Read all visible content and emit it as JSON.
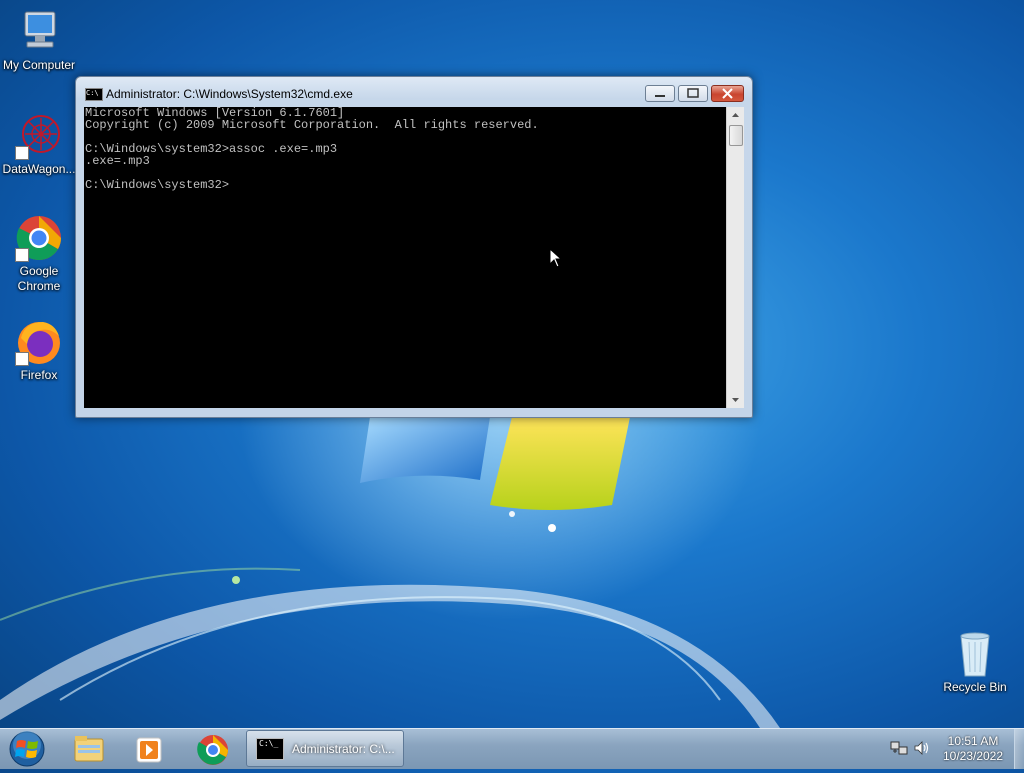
{
  "desktop": {
    "icons": [
      {
        "label": "My Computer"
      },
      {
        "label": "DataWagon..."
      },
      {
        "label": "Google Chrome"
      },
      {
        "label": "Firefox"
      },
      {
        "label": "Recycle Bin"
      }
    ]
  },
  "cmd_window": {
    "title": "Administrator: C:\\Windows\\System32\\cmd.exe",
    "icon_text": "C:\\",
    "lines": [
      "Microsoft Windows [Version 6.1.7601]",
      "Copyright (c) 2009 Microsoft Corporation.  All rights reserved.",
      "",
      "C:\\Windows\\system32>assoc .exe=.mp3",
      ".exe=.mp3",
      "",
      "C:\\Windows\\system32>"
    ],
    "colors": {
      "background": "#000000",
      "text": "#c0c0c0"
    }
  },
  "taskbar": {
    "active_task_label": "Administrator: C:\\...",
    "task_icon_text": "C:\\_",
    "clock_time": "10:51 AM",
    "clock_date": "10/23/2022",
    "pinned": [
      "file-explorer-icon",
      "media-player-icon",
      "chrome-icon"
    ],
    "tray": [
      "network-icon",
      "volume-icon"
    ]
  }
}
